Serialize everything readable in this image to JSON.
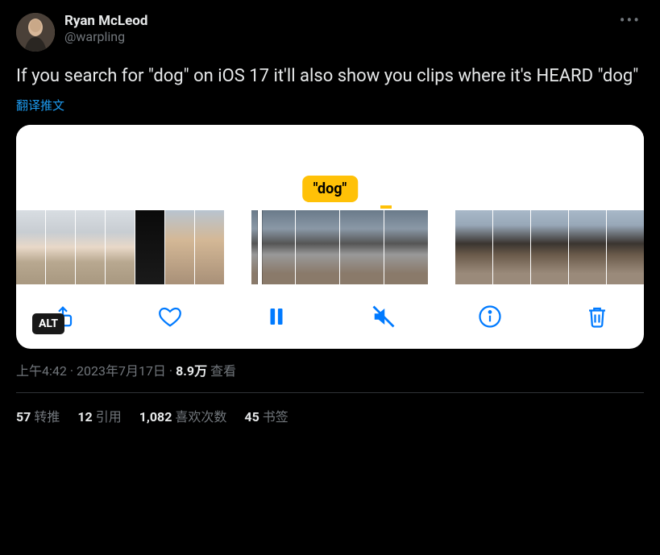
{
  "user": {
    "display_name": "Ryan McLeod",
    "handle": "@warpling"
  },
  "tweet": {
    "text": "If you search for \"dog\" on iOS 17 it'll also show you clips where it's HEARD \"dog\"",
    "translate_label": "翻译推文",
    "search_tag": "\"dog\"",
    "alt_label": "ALT"
  },
  "meta": {
    "time": "上午4:42",
    "date": "2023年7月17日",
    "views_count": "8.9万",
    "views_label": "查看",
    "sep": " · "
  },
  "stats": {
    "retweets": {
      "count": "57",
      "label": "转推"
    },
    "quotes": {
      "count": "12",
      "label": "引用"
    },
    "likes": {
      "count": "1,082",
      "label": "喜欢次数"
    },
    "bookmarks": {
      "count": "45",
      "label": "书签"
    }
  }
}
